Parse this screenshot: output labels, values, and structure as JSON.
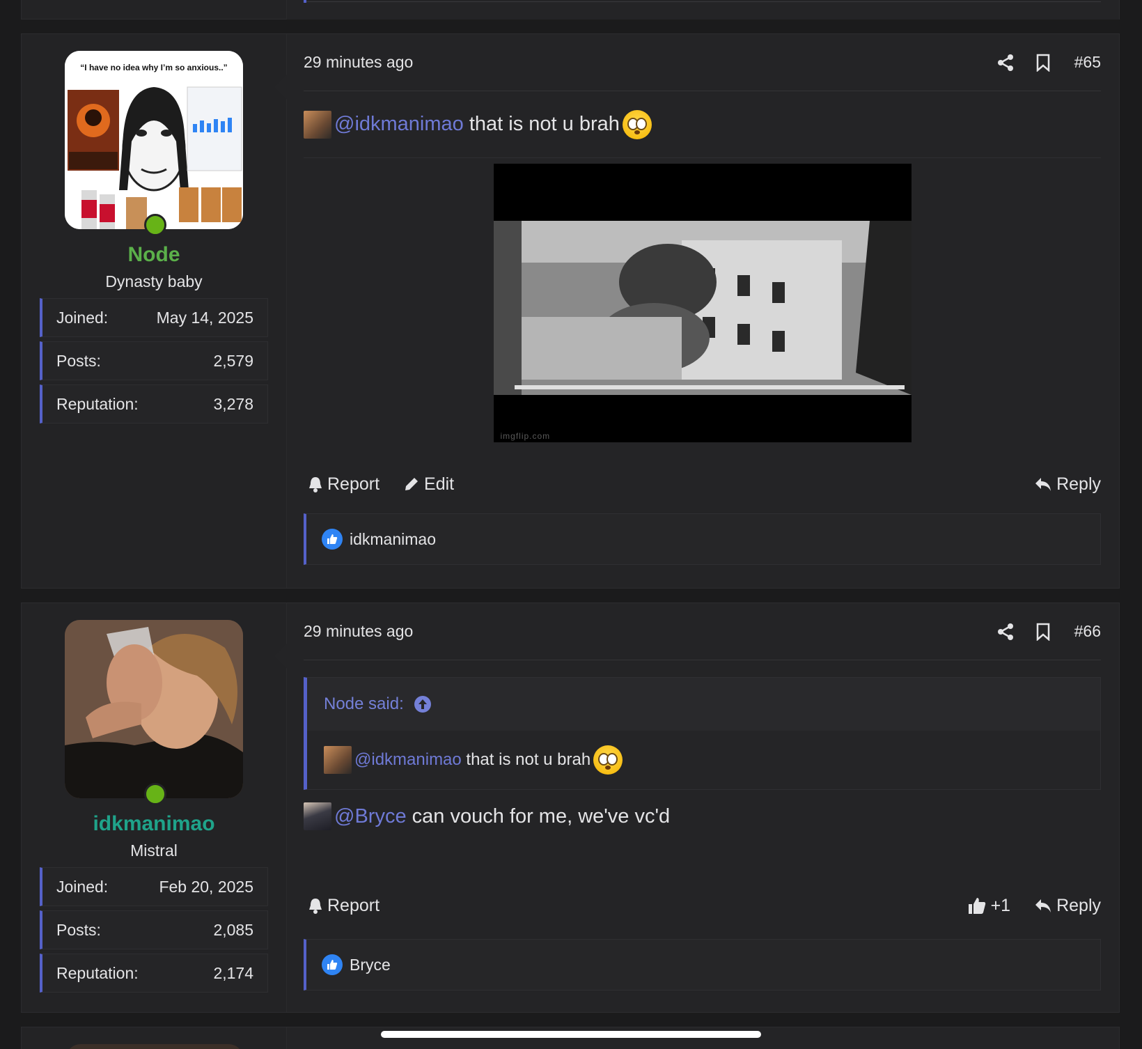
{
  "posts": [
    {
      "username": "Node",
      "username_color": "#5bb04a",
      "user_title": "Dynasty baby",
      "avatar_caption": "“I have no idea why I’m so anxious..”",
      "stats": [
        {
          "label": "Joined:",
          "value": "May 14, 2025"
        },
        {
          "label": "Posts:",
          "value": "2,579"
        },
        {
          "label": "Reputation:",
          "value": "3,278"
        }
      ],
      "time": "29 minutes ago",
      "post_number": "#65",
      "mention": "@idkmanimao",
      "message": " that is not u brah",
      "image_watermark": "imgflip.com",
      "actions": {
        "report": "Report",
        "edit": "Edit",
        "reply": "Reply"
      },
      "reactions_by": "idkmanimao"
    },
    {
      "username": "idkmanimao",
      "username_color": "#1fa38a",
      "user_title": "Mistral",
      "stats": [
        {
          "label": "Joined:",
          "value": "Feb 20, 2025"
        },
        {
          "label": "Posts:",
          "value": "2,085"
        },
        {
          "label": "Reputation:",
          "value": "2,174"
        }
      ],
      "time": "29 minutes ago",
      "post_number": "#66",
      "quote": {
        "author": "Node said:",
        "mention": "@idkmanimao",
        "message": " that is not u brah"
      },
      "mention": "@Bryce",
      "message": " can vouch for me, we've vc'd",
      "actions": {
        "report": "Report",
        "like_count": "+1",
        "reply": "Reply"
      },
      "reactions_by": "Bryce"
    }
  ],
  "colors": {
    "accent": "#5561c9",
    "mention": "#6f7ad6",
    "online": "#67b317",
    "like": "#2f84f4"
  }
}
